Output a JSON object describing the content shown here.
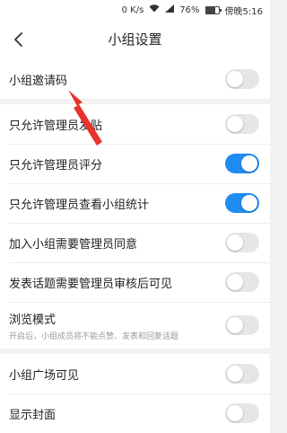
{
  "status_bar": {
    "network_speed": "0 K/s",
    "battery_percent": "76%",
    "time": "傍晚5:16",
    "battery_level": 0.76
  },
  "header": {
    "back_icon": "chevron-left-icon",
    "title": "小组设置"
  },
  "groups": [
    {
      "items": [
        {
          "label": "小组邀请码",
          "enabled": false
        }
      ]
    },
    {
      "items": [
        {
          "label": "只允许管理员发贴",
          "enabled": false
        },
        {
          "label": "只允许管理员评分",
          "enabled": true
        },
        {
          "label": "只允许管理员查看小组统计",
          "enabled": true
        },
        {
          "label": "加入小组需要管理员同意",
          "enabled": false
        },
        {
          "label": "发表话题需要管理员审核后可见",
          "enabled": false
        },
        {
          "label": "浏览模式",
          "subtitle": "开启后，小组成员将不能点赞、发表和回复话题",
          "enabled": false
        }
      ]
    },
    {
      "items": [
        {
          "label": "小组广场可见",
          "enabled": false
        },
        {
          "label": "显示封面",
          "enabled": false
        }
      ]
    }
  ],
  "colors": {
    "toggle_on": "#1f8cf2",
    "toggle_off": "#e6e6e6",
    "annotation_arrow": "#e8332d"
  }
}
